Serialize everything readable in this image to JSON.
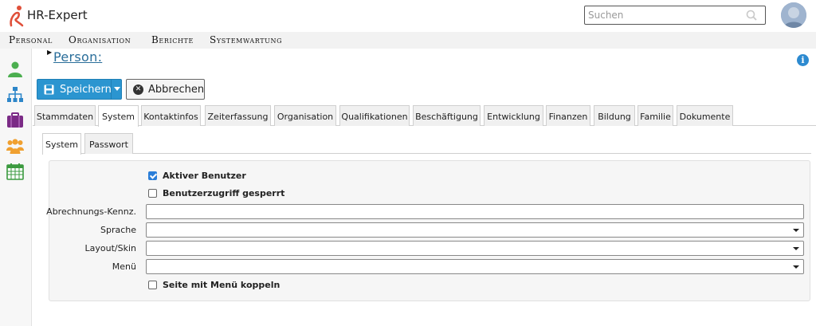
{
  "app": {
    "name": "HR-Expert",
    "brand_color": "#e0503a"
  },
  "search": {
    "placeholder": "Suchen"
  },
  "menu": {
    "items": [
      "Personal",
      "Organisation",
      "Berichte",
      "Systemwartung"
    ]
  },
  "sidebar": {
    "icons": [
      "person-icon",
      "org-chart-icon",
      "briefcase-icon",
      "group-icon",
      "calendar-icon"
    ]
  },
  "page": {
    "title": "Person:"
  },
  "toolbar": {
    "save_label": "Speichern",
    "cancel_label": "Abbrechen",
    "accent": "#2b95d0"
  },
  "tabs": [
    "Stammdaten",
    "System",
    "Kontaktinfos",
    "Zeiterfassung",
    "Organisation",
    "Qualifikationen",
    "Beschäftigung",
    "Entwicklung",
    "Finanzen",
    "Bildung",
    "Familie",
    "Dokumente"
  ],
  "active_tab": "System",
  "subtabs": [
    "System",
    "Passwort"
  ],
  "active_subtab": "System",
  "form": {
    "active_user": {
      "label": "Aktiver Benutzer",
      "checked": true
    },
    "access_locked": {
      "label": "Benutzerzugriff gesperrt",
      "checked": false
    },
    "billing_code": {
      "label": "Abrechnungs-Kennz.",
      "value": ""
    },
    "language": {
      "label": "Sprache",
      "value": ""
    },
    "layout_skin": {
      "label": "Layout/Skin",
      "value": ""
    },
    "menu": {
      "label": "Menü",
      "value": ""
    },
    "couple_page_menu": {
      "label": "Seite mit Menü koppeln",
      "checked": false
    }
  }
}
